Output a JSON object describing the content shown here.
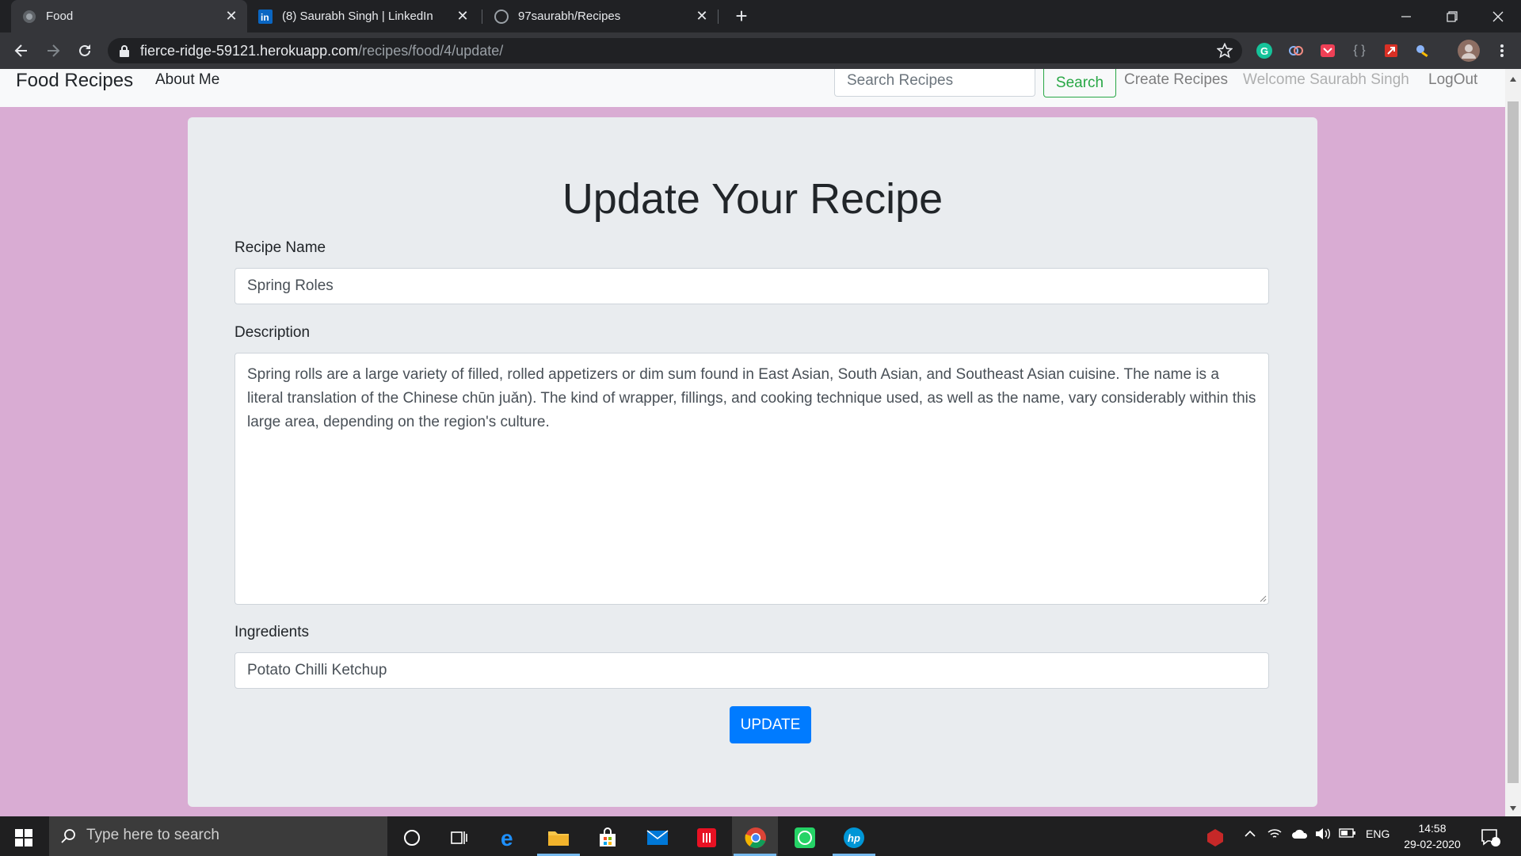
{
  "browser": {
    "tabs": [
      {
        "title": "Food",
        "active": true
      },
      {
        "title": "(8) Saurabh Singh | LinkedIn",
        "active": false
      },
      {
        "title": "97saurabh/Recipes",
        "active": false
      }
    ],
    "url_host": "fierce-ridge-59121.herokuapp.com",
    "url_path": "/recipes/food/4/update/"
  },
  "navbar": {
    "brand": "Food Recipes",
    "about": "About Me",
    "search_placeholder": "Search Recipes",
    "search_button": "Search",
    "create": "Create Recipes",
    "welcome": "Welcome Saurabh Singh",
    "logout": "LogOut"
  },
  "form": {
    "heading": "Update Your Recipe",
    "name_label": "Recipe Name",
    "name_value": "Spring Roles",
    "description_label": "Description",
    "description_value": "Spring rolls are a large variety of filled, rolled appetizers or dim sum found in East Asian, South Asian, and Southeast Asian cuisine. The name is a literal translation of the Chinese chūn juǎn). The kind of wrapper, fillings, and cooking technique used, as well as the name, vary considerably within this large area, depending on the region's culture.",
    "ingredients_label": "Ingredients",
    "ingredients_value": "Potato Chilli Ketchup",
    "submit": "UPDATE"
  },
  "taskbar": {
    "search_placeholder": "Type here to search",
    "language": "ENG",
    "time": "14:58",
    "date": "29-02-2020",
    "notification_count": "4"
  },
  "colors": {
    "page_bg": "#d9acd3",
    "card_bg": "#e9ecef",
    "primary": "#007bff",
    "success": "#28a745"
  }
}
